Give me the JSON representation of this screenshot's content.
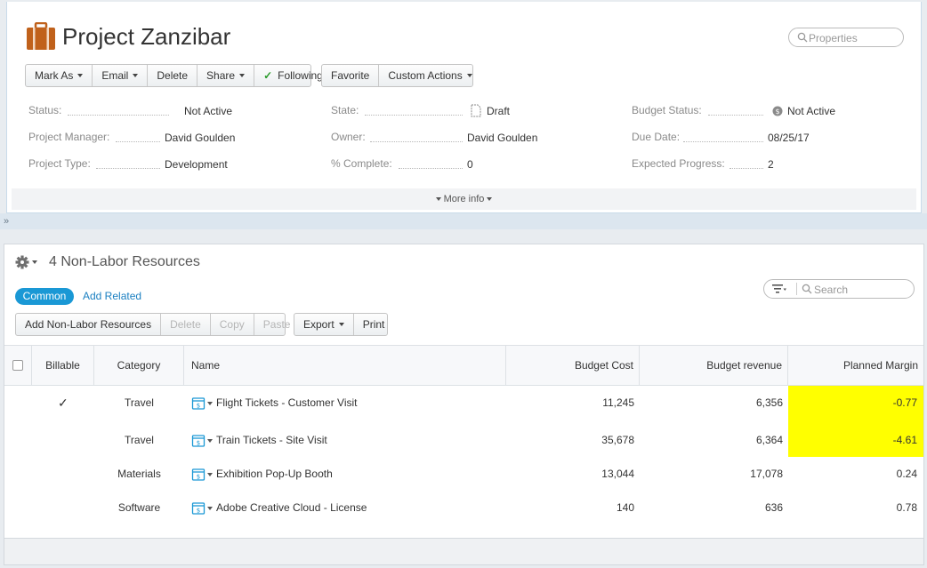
{
  "project": {
    "title": "Project Zanzibar",
    "icon": "briefcase-icon",
    "search_placeholder": "Properties"
  },
  "toolbar": {
    "mark_as": "Mark As",
    "email": "Email",
    "delete": "Delete",
    "share": "Share",
    "following": "Following",
    "favorite": "Favorite",
    "custom_actions": "Custom Actions"
  },
  "fields": {
    "status": {
      "label": "Status:",
      "value": "Not Active"
    },
    "project_manager": {
      "label": "Project Manager:",
      "value": "David Goulden"
    },
    "project_type": {
      "label": "Project Type:",
      "value": "Development"
    },
    "state": {
      "label": "State:",
      "value": "Draft"
    },
    "owner": {
      "label": "Owner:",
      "value": "David Goulden"
    },
    "percent_complete": {
      "label": "% Complete:",
      "value": "0"
    },
    "budget_status": {
      "label": "Budget Status:",
      "value": "Not Active"
    },
    "due_date": {
      "label": "Due Date:",
      "value": "08/25/17"
    },
    "expected_progress": {
      "label": "Expected Progress:",
      "value": "2"
    }
  },
  "more_info": "More info",
  "resources": {
    "title": "4 Non-Labor Resources",
    "common_tab": "Common",
    "add_related": "Add Related",
    "search_placeholder": "Search",
    "actions": {
      "add": "Add Non-Labor Resources",
      "delete": "Delete",
      "copy": "Copy",
      "paste": "Paste",
      "export": "Export",
      "print": "Print"
    },
    "columns": {
      "billable": "Billable",
      "category": "Category",
      "name": "Name",
      "budget_cost": "Budget Cost",
      "budget_revenue": "Budget revenue",
      "planned_margin": "Planned Margin"
    },
    "rows": [
      {
        "billable": "✓",
        "category": "Travel",
        "name": "Flight Tickets - Customer Visit",
        "budget_cost": "11,245",
        "budget_revenue": "6,356",
        "planned_margin": "-0.77",
        "highlight": "#ffff00"
      },
      {
        "billable": "",
        "category": "Travel",
        "name": "Train Tickets - Site Visit",
        "budget_cost": "35,678",
        "budget_revenue": "6,364",
        "planned_margin": "-4.61",
        "highlight": "#ffff00"
      },
      {
        "billable": "",
        "category": "Materials",
        "name": "Exhibition Pop-Up Booth",
        "budget_cost": "13,044",
        "budget_revenue": "17,078",
        "planned_margin": "0.24",
        "highlight": ""
      },
      {
        "billable": "",
        "category": "Software",
        "name": "Adobe Creative Cloud - License",
        "budget_cost": "140",
        "budget_revenue": "636",
        "planned_margin": "0.78",
        "highlight": ""
      }
    ]
  },
  "colors": {
    "accent": "#1a98d5",
    "project_icon": "#c0611b",
    "highlight": "#ffff00"
  }
}
